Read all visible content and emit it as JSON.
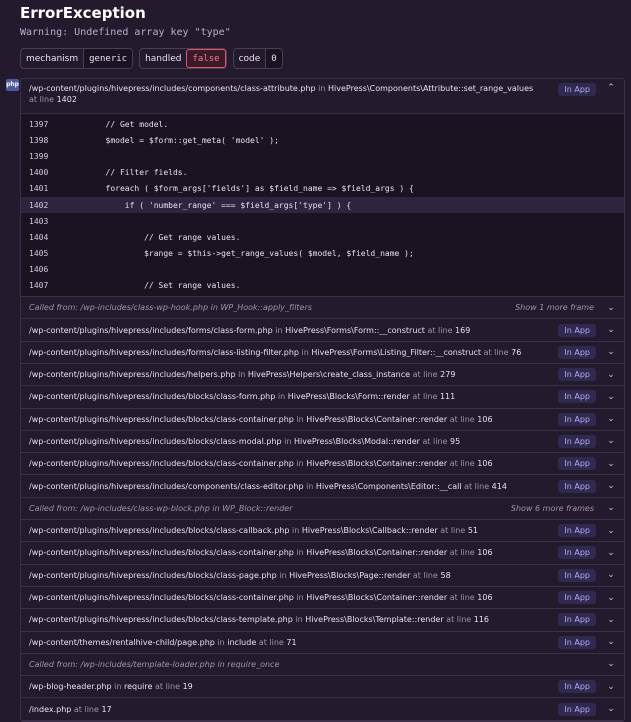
{
  "header": {
    "title": "ErrorException",
    "message": "Warning: Undefined array key \"type\"",
    "tags": [
      {
        "key": "mechanism",
        "value": "generic"
      },
      {
        "key": "handled",
        "value": "false"
      },
      {
        "key": "code",
        "value": "0"
      }
    ]
  },
  "platform_badge": "php",
  "in_app_label": "In App",
  "first_frame": {
    "path": "/wp-content/plugins/hivepress/includes/components/class-attribute.php",
    "in_word": "in",
    "function": "HivePress\\Components\\Attribute::set_range_values",
    "at_line": "at line",
    "line": "1402",
    "code": [
      {
        "n": "1397",
        "src": "        // Get model."
      },
      {
        "n": "1398",
        "src": "        $model = $form::get_meta( 'model' );"
      },
      {
        "n": "1399",
        "src": ""
      },
      {
        "n": "1400",
        "src": "        // Filter fields."
      },
      {
        "n": "1401",
        "src": "        foreach ( $form_args['fields'] as $field_name => $field_args ) {"
      },
      {
        "n": "1402",
        "src": "            if ( 'number_range' === $field_args['type'] ) {"
      },
      {
        "n": "1403",
        "src": ""
      },
      {
        "n": "1404",
        "src": "                // Get range values."
      },
      {
        "n": "1405",
        "src": "                $range = $this->get_range_values( $model, $field_name );"
      },
      {
        "n": "1406",
        "src": ""
      },
      {
        "n": "1407",
        "src": "                // Set range values."
      }
    ]
  },
  "rows": [
    {
      "type": "called",
      "text": "Called from: /wp-includes/class-wp-hook.php  in  WP_Hook::apply_filters",
      "more": "Show 1 more frame"
    },
    {
      "type": "frame",
      "path": "/wp-content/plugins/hivepress/includes/forms/class-form.php",
      "fn": "HivePress\\Forms\\Form::__construct",
      "line": "169"
    },
    {
      "type": "frame",
      "path": "/wp-content/plugins/hivepress/includes/forms/class-listing-filter.php",
      "fn": "HivePress\\Forms\\Listing_Filter::__construct",
      "line": "76"
    },
    {
      "type": "frame",
      "path": "/wp-content/plugins/hivepress/includes/helpers.php",
      "fn": "HivePress\\Helpers\\create_class_instance",
      "line": "279"
    },
    {
      "type": "frame",
      "path": "/wp-content/plugins/hivepress/includes/blocks/class-form.php",
      "fn": "HivePress\\Blocks\\Form::render",
      "line": "111"
    },
    {
      "type": "frame",
      "path": "/wp-content/plugins/hivepress/includes/blocks/class-container.php",
      "fn": "HivePress\\Blocks\\Container::render",
      "line": "106"
    },
    {
      "type": "frame",
      "path": "/wp-content/plugins/hivepress/includes/blocks/class-modal.php",
      "fn": "HivePress\\Blocks\\Modal::render",
      "line": "95"
    },
    {
      "type": "frame",
      "path": "/wp-content/plugins/hivepress/includes/blocks/class-container.php",
      "fn": "HivePress\\Blocks\\Container::render",
      "line": "106"
    },
    {
      "type": "frame",
      "path": "/wp-content/plugins/hivepress/includes/components/class-editor.php",
      "fn": "HivePress\\Components\\Editor::__call",
      "line": "414"
    },
    {
      "type": "called",
      "text": "Called from: /wp-includes/class-wp-block.php  in  WP_Block::render",
      "more": "Show 6 more frames"
    },
    {
      "type": "frame",
      "path": "/wp-content/plugins/hivepress/includes/blocks/class-callback.php",
      "fn": "HivePress\\Blocks\\Callback::render",
      "line": "51"
    },
    {
      "type": "frame",
      "path": "/wp-content/plugins/hivepress/includes/blocks/class-container.php",
      "fn": "HivePress\\Blocks\\Container::render",
      "line": "106"
    },
    {
      "type": "frame",
      "path": "/wp-content/plugins/hivepress/includes/blocks/class-page.php",
      "fn": "HivePress\\Blocks\\Page::render",
      "line": "58"
    },
    {
      "type": "frame",
      "path": "/wp-content/plugins/hivepress/includes/blocks/class-container.php",
      "fn": "HivePress\\Blocks\\Container::render",
      "line": "106"
    },
    {
      "type": "frame",
      "path": "/wp-content/plugins/hivepress/includes/blocks/class-template.php",
      "fn": "HivePress\\Blocks\\Template::render",
      "line": "116"
    },
    {
      "type": "frame",
      "path": "/wp-content/themes/rentalhive-child/page.php",
      "fn": "include",
      "line": "71"
    },
    {
      "type": "called",
      "text": "Called from: /wp-includes/template-loader.php  in  require_once",
      "more": ""
    },
    {
      "type": "frame",
      "path": "/wp-blog-header.php",
      "fn": "require",
      "line": "19"
    },
    {
      "type": "frame",
      "path": "/index.php",
      "fn": "",
      "line": "17"
    }
  ]
}
